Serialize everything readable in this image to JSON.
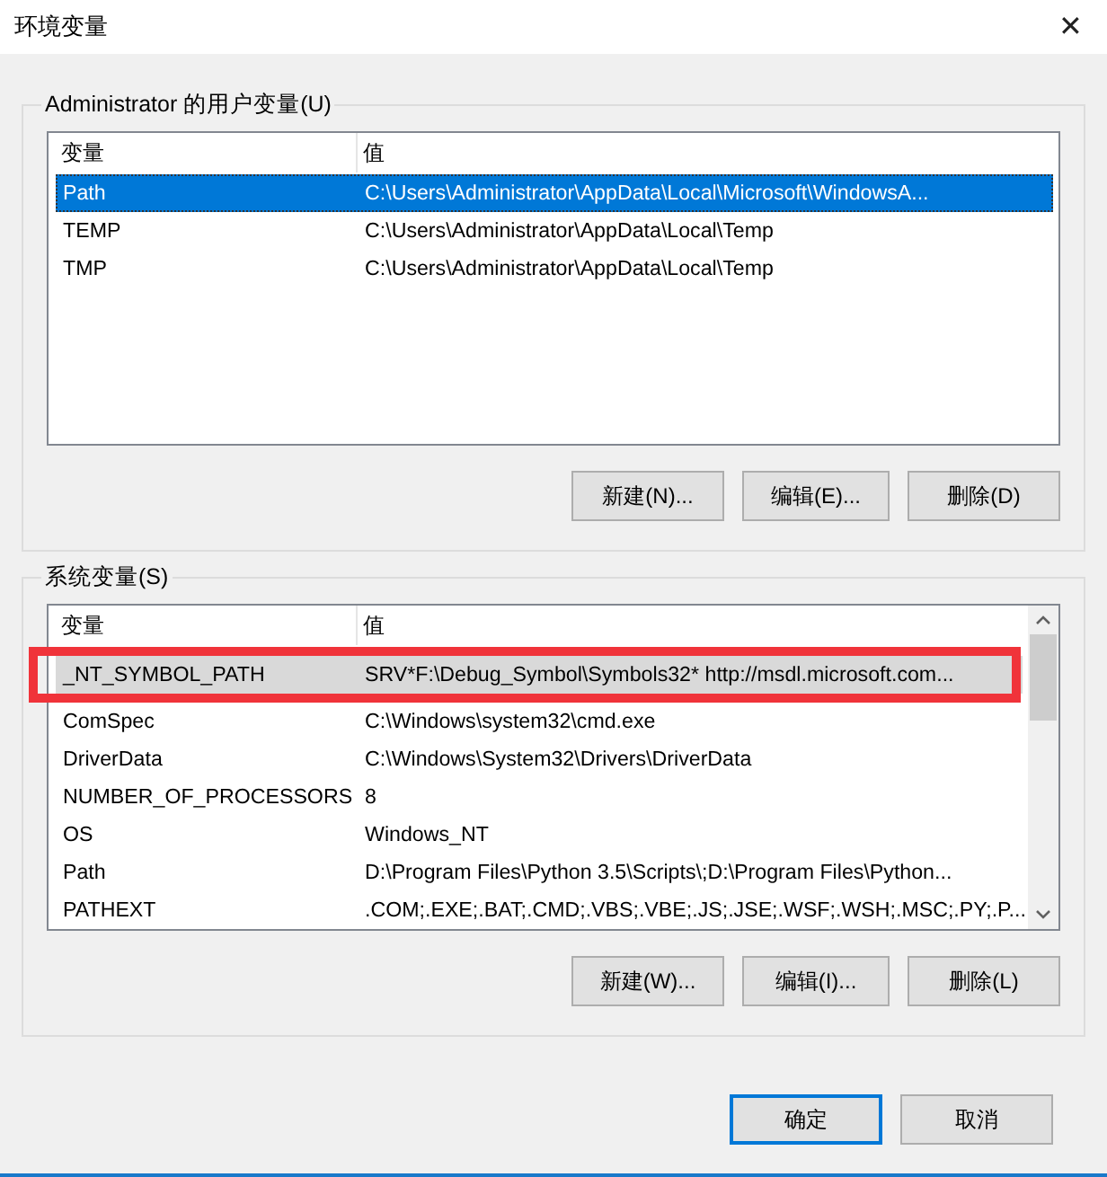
{
  "window": {
    "title": "环境变量",
    "close": "✕"
  },
  "groups": [
    {
      "title": "Administrator 的用户变量(U)",
      "focused": true,
      "scrollbar": false,
      "columns": [
        "变量",
        "值"
      ],
      "rows": [
        {
          "name": "Path",
          "value": "C:\\Users\\Administrator\\AppData\\Local\\Microsoft\\WindowsA...",
          "selected": true
        },
        {
          "name": "TEMP",
          "value": "C:\\Users\\Administrator\\AppData\\Local\\Temp",
          "selected": false
        },
        {
          "name": "TMP",
          "value": "C:\\Users\\Administrator\\AppData\\Local\\Temp",
          "selected": false
        }
      ],
      "buttons": [
        "新建(N)...",
        "编辑(E)...",
        "删除(D)"
      ]
    },
    {
      "title": "系统变量(S)",
      "focused": false,
      "scrollbar": true,
      "columns": [
        "变量",
        "值"
      ],
      "rows": [
        {
          "name": "_NT_SYMBOL_PATH",
          "value": "SRV*F:\\Debug_Symbol\\Symbols32* http://msdl.microsoft.com...",
          "selected": true,
          "highlighted": true
        },
        {
          "name": "ComSpec",
          "value": "C:\\Windows\\system32\\cmd.exe",
          "selected": false
        },
        {
          "name": "DriverData",
          "value": "C:\\Windows\\System32\\Drivers\\DriverData",
          "selected": false
        },
        {
          "name": "NUMBER_OF_PROCESSORS",
          "value": "8",
          "selected": false
        },
        {
          "name": "OS",
          "value": "Windows_NT",
          "selected": false
        },
        {
          "name": "Path",
          "value": "D:\\Program Files\\Python 3.5\\Scripts\\;D:\\Program Files\\Python...",
          "selected": false
        },
        {
          "name": "PATHEXT",
          "value": ".COM;.EXE;.BAT;.CMD;.VBS;.VBE;.JS;.JSE;.WSF;.WSH;.MSC;.PY;.P...",
          "selected": false
        }
      ],
      "buttons": [
        "新建(W)...",
        "编辑(I)...",
        "删除(L)"
      ]
    }
  ],
  "footer": [
    {
      "label": "确定",
      "default": true
    },
    {
      "label": "取消",
      "default": false
    }
  ]
}
